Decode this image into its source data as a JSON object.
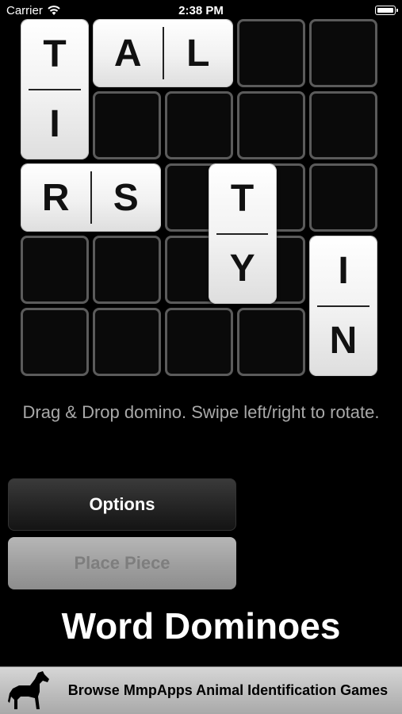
{
  "status_bar": {
    "carrier": "Carrier",
    "time": "2:38 PM"
  },
  "board": {
    "rows": 5,
    "cols": 5,
    "dominoes": [
      {
        "id": "tal",
        "orientation": "horizontal",
        "row": 0,
        "col": 1,
        "letters": [
          "A",
          "L"
        ]
      },
      {
        "id": "ti",
        "orientation": "vertical",
        "row": 0,
        "col": 0,
        "letters": [
          "T",
          "I"
        ]
      },
      {
        "id": "rs",
        "orientation": "horizontal",
        "row": 2,
        "col": 0,
        "letters": [
          "R",
          "S"
        ]
      },
      {
        "id": "ty",
        "orientation": "vertical",
        "row": 2,
        "col": 2.6,
        "letters": [
          "T",
          "Y"
        ]
      },
      {
        "id": "in",
        "orientation": "vertical",
        "row": 3,
        "col": 4,
        "letters": [
          "I",
          "N"
        ]
      }
    ]
  },
  "instructions": "Drag & Drop domino. Swipe left/right to rotate.",
  "buttons": {
    "options": "Options",
    "place_piece": "Place Piece"
  },
  "app_title": "Word Dominoes",
  "ad": {
    "text": "Browse MmpApps Animal Identification Games",
    "icon": "horse-icon"
  }
}
